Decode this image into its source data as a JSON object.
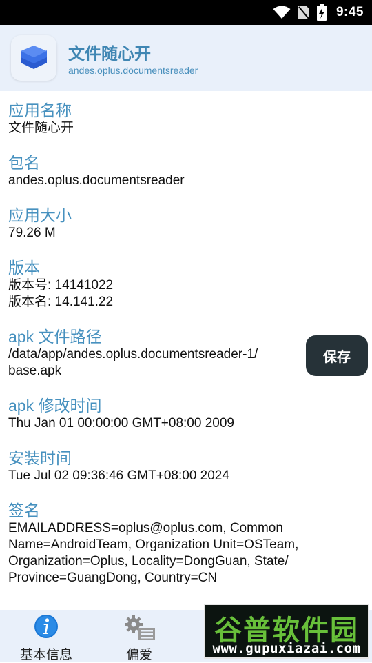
{
  "status_bar": {
    "time": "9:45",
    "icons": [
      "wifi-icon",
      "no-sim-icon",
      "battery-charging-icon"
    ]
  },
  "app": {
    "name": "文件随心开",
    "package": "andes.oplus.documentsreader",
    "icon": "layers-icon"
  },
  "sections": {
    "app_name": {
      "label": "应用名称",
      "value": "文件随心开"
    },
    "package": {
      "label": "包名",
      "value": "andes.oplus.documentsreader"
    },
    "size": {
      "label": "应用大小",
      "value": "79.26 M"
    },
    "version": {
      "label": "版本",
      "value": "版本号: 14141022\n版本名: 14.141.22"
    },
    "apk_path": {
      "label": "apk 文件路径",
      "value": "/data/app/andes.oplus.documentsreader-1/\nbase.apk"
    },
    "apk_modified": {
      "label": "apk 修改时间",
      "value": "Thu Jan 01 00:00:00 GMT+08:00 2009"
    },
    "install_time": {
      "label": "安装时间",
      "value": "Tue Jul 02 09:36:46 GMT+08:00 2024"
    },
    "signature": {
      "label": "签名",
      "value": "EMAILADDRESS=oplus@oplus.com, Common\nName=AndroidTeam, Organization Unit=OSTeam,\nOrganization=Oplus, Locality=DongGuan, State/\nProvince=GuangDong, Country=CN"
    }
  },
  "save_button": {
    "label": "保存"
  },
  "bottom_nav": {
    "items": [
      {
        "label": "基本信息",
        "icon": "info-icon"
      },
      {
        "label": "偏爱",
        "icon": "gear-list-icon"
      }
    ]
  },
  "watermark": {
    "text_cn": "谷普软件园",
    "url": "www.gupuxiazai.com"
  },
  "colors": {
    "accent": "#4791bf",
    "header_bg": "#e9f0fa",
    "button_bg": "#263238"
  }
}
